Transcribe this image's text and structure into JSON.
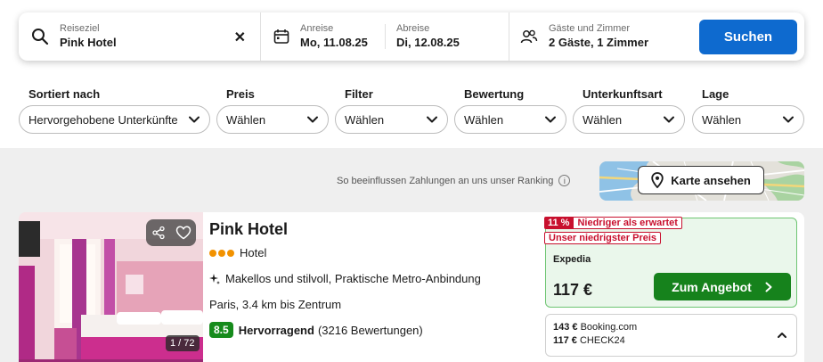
{
  "search": {
    "destination_label": "Reiseziel",
    "destination_value": "Pink Hotel",
    "clear_icon": "close-icon",
    "checkin_label": "Anreise",
    "checkin_value": "Mo, 11.08.25",
    "checkout_label": "Abreise",
    "checkout_value": "Di, 12.08.25",
    "guests_label": "Gäste und Zimmer",
    "guests_value": "2 Gäste, 1 Zimmer",
    "search_button": "Suchen",
    "accent_color": "#0e6acf"
  },
  "filters": [
    {
      "label": "Sortiert nach",
      "value": "Hervorgehobene Unterkünfte"
    },
    {
      "label": "Preis",
      "value": "Wählen"
    },
    {
      "label": "Filter",
      "value": "Wählen"
    },
    {
      "label": "Bewertung",
      "value": "Wählen"
    },
    {
      "label": "Unterkunftsart",
      "value": "Wählen"
    },
    {
      "label": "Lage",
      "value": "Wählen"
    }
  ],
  "ranking_note": "So beeinflussen Zahlungen an uns unser Ranking",
  "ranking_info_icon": "i",
  "map_button": "Karte ansehen",
  "hotel": {
    "name": "Pink Hotel",
    "type": "Hotel",
    "stars": 3,
    "highlights": "Makellos und stilvoll, Praktische Metro-Anbindung",
    "location": "Paris, 3.4 km bis Zentrum",
    "rating_score": "8.5",
    "rating_word": "Hervorragend",
    "rating_count": "(3216 Bewertungen)",
    "photo_counter": "1 / 72",
    "deal": {
      "discount_pct": "11 %",
      "discount_text": "Niedriger als erwartet",
      "lowest_price_text": "Unser niedrigster Preis",
      "provider": "Expedia",
      "price": "117 €",
      "button": "Zum Angebot"
    },
    "other_offers": [
      {
        "price": "143 €",
        "provider": "Booking.com"
      },
      {
        "price": "117 €",
        "provider": "CHECK24"
      }
    ]
  },
  "colors": {
    "deal_green": "#16821c",
    "badge_red": "#c8102e",
    "star_orange": "#f29200"
  }
}
